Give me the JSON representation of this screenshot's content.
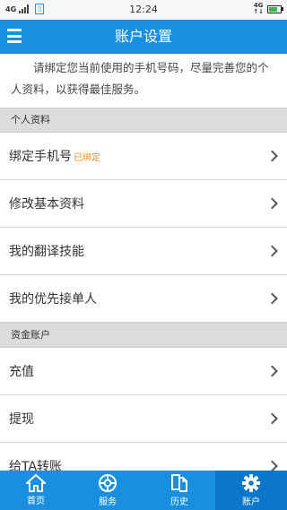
{
  "status_bar": {
    "network": "4G",
    "time": "12:24",
    "network_right": "4G"
  },
  "header": {
    "title": "账户设置"
  },
  "intro": {
    "text": "请绑定您当前使用的手机号码，尽量完善您的个人资料，以获得最佳服务。"
  },
  "sections": {
    "personal": {
      "title": "个人资料",
      "items": [
        {
          "label": "绑定手机号",
          "badge": "已绑定"
        },
        {
          "label": "修改基本资料"
        },
        {
          "label": "我的翻译技能"
        },
        {
          "label": "我的优先接单人"
        }
      ]
    },
    "funds": {
      "title": "资金账户",
      "items": [
        {
          "label": "充值"
        },
        {
          "label": "提现"
        },
        {
          "label": "给TA转账"
        }
      ]
    }
  },
  "tabbar": {
    "tabs": [
      {
        "label": "首页",
        "icon": "home-icon"
      },
      {
        "label": "服务",
        "icon": "service-icon"
      },
      {
        "label": "历史",
        "icon": "history-icon"
      },
      {
        "label": "账户",
        "icon": "gear-icon",
        "active": true
      }
    ]
  },
  "colors": {
    "primary": "#1a8fdf",
    "active_tab": "#0a77cc",
    "badge": "#f08a24"
  }
}
